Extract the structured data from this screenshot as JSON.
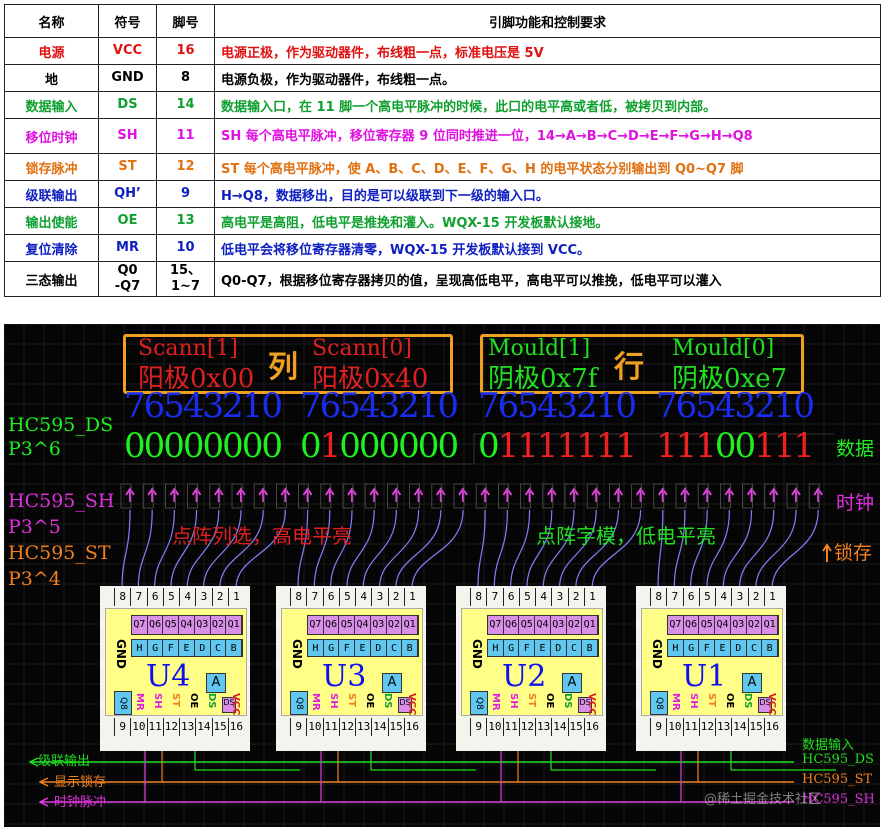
{
  "table": {
    "headers": [
      "名称",
      "符号",
      "脚号",
      "引脚功能和控制要求"
    ],
    "rows": [
      {
        "name": "电源",
        "symbol": "VCC",
        "pin": "16",
        "desc": "电源正极，作为驱动器件，布线粗一点，标准电压是 5V",
        "color": "#e01010"
      },
      {
        "name": "地",
        "symbol": "GND",
        "pin": "8",
        "desc": "电源负极，作为驱动器件，布线粗一点。",
        "color": "#000000"
      },
      {
        "name": "数据输入",
        "symbol": "DS",
        "pin": "14",
        "desc": "数据输入口，在 11 脚一个高电平脉冲的时候，此口的电平高或者低，被拷贝到内部。",
        "color": "#10a030"
      },
      {
        "name": "移位时钟",
        "symbol": "SH",
        "pin": "11",
        "desc": "SH 每个高电平脉冲，移位寄存器 9 位同时推进一位，14→A→B→C→D→E→F→G→H→Q8",
        "color": "#e010e0"
      },
      {
        "name": "锁存脉冲",
        "symbol": "ST",
        "pin": "12",
        "desc": "ST 每个高电平脉冲，使 A、B、C、D、E、F、G、H 的电平状态分别输出到 Q0~Q7 脚",
        "color": "#e07010"
      },
      {
        "name": "级联输出",
        "symbol": "QH’",
        "pin": "9",
        "desc": "H→Q8，数据移出，目的是可以级联到下一级的输入口。",
        "color": "#1020c0"
      },
      {
        "name": "输出使能",
        "symbol": "OE",
        "pin": "13",
        "desc": "高电平是高阻，低电平是推挽和灌入。WQX-15 开发板默认接地。",
        "color": "#10a030"
      },
      {
        "name": "复位清除",
        "symbol": "MR",
        "pin": "10",
        "desc": "低电平会将移位寄存器清零，WQX-15 开发板默认接到 VCC。",
        "color": "#1020c0"
      },
      {
        "name": "三态输出",
        "symbol": "Q0\n-Q7",
        "pin": "15、\n1~7",
        "desc": "Q0-Q7，根据移位寄存器拷贝的值，呈现高低电平，高电平可以推挽，低电平可以灌入",
        "color": "#000000"
      }
    ]
  },
  "diagram": {
    "boxes": [
      {
        "top": "Scann[1]",
        "bottom": "阳极0x00",
        "top2": "Scann[0]",
        "bottom2": "阳极0x40",
        "mid": "列"
      },
      {
        "top": "Mould[1]",
        "bottom": "阴极0x7f",
        "top2": "Mould[0]",
        "bottom2": "阴极0xe7",
        "mid": "行"
      }
    ],
    "bitindex": [
      "76543210",
      "76543210",
      "76543210",
      "76543210"
    ],
    "data_groups": [
      {
        "green": "00000000",
        "red": ""
      },
      {
        "green": "0",
        "red": "1",
        "green2": "000000"
      },
      {
        "green": "0",
        "red": "1111111"
      },
      {
        "red": "111",
        "green": "00",
        "red2": "111"
      }
    ],
    "left_labels": {
      "ds": "HC595_DS",
      "p36": "P3^6",
      "sh": "HC595_SH",
      "p35": "P3^5",
      "st": "HC595_ST",
      "p34": "P3^4"
    },
    "right_labels": {
      "data": "数据",
      "clock": "时钟",
      "latch": "锁存"
    },
    "notes": {
      "col": "点阵列选，高电平亮",
      "row": "点阵字模，低电平亮"
    },
    "chips": [
      {
        "name": "U4"
      },
      {
        "name": "U3"
      },
      {
        "name": "U2"
      },
      {
        "name": "U1"
      }
    ],
    "pins_top": [
      "8",
      "7",
      "6",
      "5",
      "4",
      "3",
      "2",
      "1"
    ],
    "pins_bottom": [
      "9",
      "10",
      "11",
      "12",
      "13",
      "14",
      "15",
      "16"
    ],
    "q_labels": [
      "Q7",
      "Q6",
      "Q5",
      "Q4",
      "Q3",
      "Q2",
      "Q1"
    ],
    "h_labels": [
      "H",
      "G",
      "F",
      "E",
      "D",
      "C",
      "B"
    ],
    "gnd": "GND",
    "a_label": "A",
    "q8": "Q8",
    "ds_small": "DS",
    "pin_labels": [
      "MR",
      "SH",
      "ST",
      "OE",
      "DS",
      "VCC"
    ],
    "bottom_left": {
      "cascade": "级联输出",
      "latch": "显示锁存",
      "clock": "时钟脉冲"
    },
    "bottom_right": {
      "data": "数据输入",
      "ds": "HC595_DS",
      "st": "HC595_ST",
      "sh": "HC595_SH"
    },
    "watermark": "@稀土掘金技术社区"
  }
}
